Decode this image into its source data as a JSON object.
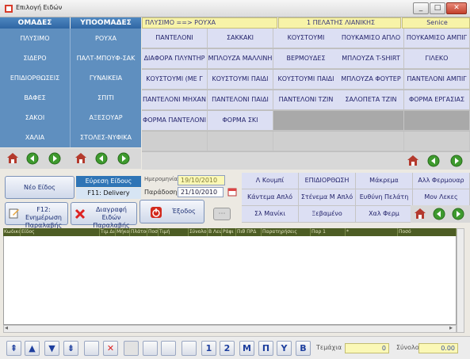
{
  "window": {
    "title": "Επιλογή Ειδών",
    "close_label": "Close",
    "minimize_label": "_",
    "maximize_label": "□"
  },
  "header": {
    "groups_title": "ΟΜΑΔΕΣ",
    "subgroups_title": "ΥΠΟΟΜΑΔΕΣ",
    "path": "ΠΛΥΣΙΜΟ ==> ΡΟΥΧΑ",
    "customer": "1 ΠΕΛΑΤΗΣ ΛΙΑΝΙΚΗΣ",
    "user": "Senice"
  },
  "groups": [
    {
      "group": "ΠΛΥΣΙΜΟ",
      "subgroup": "ΡΟΥΧΑ"
    },
    {
      "group": "ΣΙΔΕΡΟ",
      "subgroup": "ΠΑΛΤ-ΜΠΟΥΦ-ΣΑΚ"
    },
    {
      "group": "ΕΠΙΔΙΟΡΘΩΣΕΙΣ",
      "subgroup": "ΓΥΝΑΙΚΕΙΑ"
    },
    {
      "group": "ΒΑΦΕΣ",
      "subgroup": "ΣΠΙΤΙ"
    },
    {
      "group": "ΣΑΚΟΙ",
      "subgroup": "ΑΞΕΣΟΥΑΡ"
    },
    {
      "group": "ΧΑΛΙΑ",
      "subgroup": "ΣΤΟΛΕΣ-ΝΥΦΙΚΑ"
    }
  ],
  "items": [
    [
      "ΠΑΝΤΕΛΟΝΙ",
      "ΣΑΚΚΑΚΙ",
      "ΚΟΥΣΤΟΥΜΙ",
      "ΠΟΥΚΑΜΙΣΟ ΑΠΛΟ",
      "ΠΟΥΚΑΜΙΣΟ ΑΜΠΙΓ"
    ],
    [
      "ΔΙΑΦΟΡΑ ΠΛΥΝΤΗΡ",
      "ΜΠΛΟΥΖΑ ΜΑΛΛΙΝΗ",
      "ΒΕΡΜΟΥΔΕΣ",
      "ΜΠΛΟΥΖΑ T-SHIRT",
      "ΓΙΛΕΚΟ"
    ],
    [
      "ΚΟΥΣΤΟΥΜΙ (ΜΕ Γ",
      "ΚΟΥΣΤΟΥΜΙ ΠΑΙΔΙ",
      "ΚΟΥΣΤΟΥΜΙ ΠΑΙΔΙ",
      "ΜΠΛΟΥΖΑ ΦΟΥΤΕΡ",
      "ΠΑΝΤΕΛΟΝΙ ΑΜΠΙΓ"
    ],
    [
      "ΠΑΝΤΕΛΟΝΙ ΜΗΧΑΝ",
      "ΠΑΝΤΕΛΟΝΙ ΠΑΙΔΙ",
      "ΠΑΝΤΕΛΟΝΙ ΤΖΙΝ",
      "ΣΑΛΟΠΕΤΑ ΤΖΙΝ",
      "ΦΟΡΜΑ ΕΡΓΑΣΙΑΣ"
    ],
    [
      "ΦΟΡΜΑ ΠΑΝΤΕΛΟΝΙ",
      "ΦΟΡΜΑ ΣΚΙ",
      "",
      "",
      ""
    ],
    [
      "",
      "",
      "",
      "",
      ""
    ]
  ],
  "actions": {
    "new_item": "Νέο Είδος",
    "search_item": "Εύρεση Είδους",
    "delivery": "F11: Delivery",
    "update_receipt": "F12: Ενημέρωση Παραλαβής",
    "delete_receipt": "Διαγραφή Ειδών Παραλαβής",
    "exit": "Έξοδος"
  },
  "dates": {
    "date_label": "Ημερομηνία",
    "date_value": "19/10/2010",
    "delivery_label": "Παράδοση",
    "delivery_value": "21/10/2010"
  },
  "notes": [
    [
      "Λ Κουμπί",
      "ΕΠΙΔΙΟΡΘΩΣΗ",
      "Μάκρεμα",
      "Αλλ Φερμουαρ"
    ],
    [
      "Κάντεμα Απλό",
      "Στένεμα Μ Απλό",
      "Ευθύνη Πελάτη",
      "Μον Λεκες"
    ],
    [
      "Σλ Μανίκι",
      "Ξεβαμένο",
      "Χαλ Φερμ",
      ""
    ]
  ],
  "table": {
    "columns": [
      "Κωδικός",
      "Είδος",
      "Τιμ Διακ",
      "Μήκος",
      "Πλάτος",
      "Ποσ",
      "Τιμή",
      "Σύνολο",
      "Β Λευ",
      "Ράφι",
      "Πιθ ΠΡΔ",
      "Παρατηρήσεις",
      "Παρ 1",
      "*",
      "Ποσό"
    ]
  },
  "toolbar": {
    "labels": [
      "⇞",
      "▲",
      "▼",
      "⇟",
      "",
      "✕",
      "",
      "",
      "",
      "",
      "1",
      "2",
      "M",
      "Π",
      "Y",
      "B"
    ],
    "qty_label": "Τεμάχια",
    "qty_value": "0",
    "total_label": "Σύνολο",
    "total_value": "0.00"
  },
  "colors": {
    "header_blue": "#2f66a4",
    "group_blue": "#5f8fbf",
    "item_cell": "#dcdff3",
    "table_header": "#4d5d24"
  }
}
